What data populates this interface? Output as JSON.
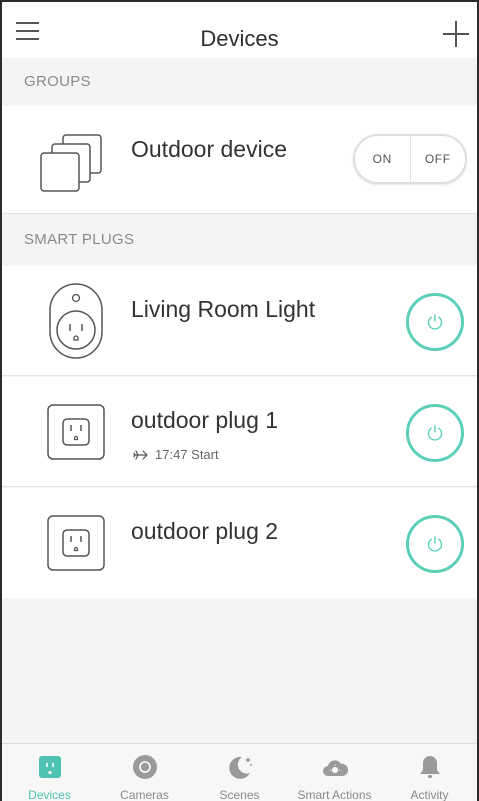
{
  "header": {
    "title": "Devices",
    "menu_icon": "hamburger-menu-icon",
    "add_icon": "plus-icon"
  },
  "groups": {
    "section_label": "GROUPS",
    "items": [
      {
        "name": "Outdoor device",
        "icon": "device-group-icon",
        "toggle_on": "ON",
        "toggle_off": "OFF"
      }
    ]
  },
  "smart_plugs": {
    "section_label": "SMART PLUGS",
    "items": [
      {
        "name": "Living Room Light",
        "icon": "smart-plug-icon",
        "power_icon": "power-icon"
      },
      {
        "name": "outdoor plug 1",
        "icon": "outlet-icon",
        "schedule_icon": "airplane-icon",
        "schedule": "17:47 Start",
        "power_icon": "power-icon"
      },
      {
        "name": "outdoor plug 2",
        "icon": "outlet-icon",
        "power_icon": "power-icon"
      }
    ]
  },
  "tabbar": {
    "items": [
      {
        "label": "Devices",
        "icon": "devices-icon",
        "active": true
      },
      {
        "label": "Cameras",
        "icon": "camera-icon",
        "active": false
      },
      {
        "label": "Scenes",
        "icon": "moon-stars-icon",
        "active": false
      },
      {
        "label": "Smart Actions",
        "icon": "cloud-sun-icon",
        "active": false
      },
      {
        "label": "Activity",
        "icon": "bell-icon",
        "active": false
      }
    ]
  },
  "colors": {
    "accent": "#5ccfb9",
    "tab_active": "#4ec3b1",
    "tab_inactive": "#8a8a8a",
    "background": "#f4f4f4"
  }
}
